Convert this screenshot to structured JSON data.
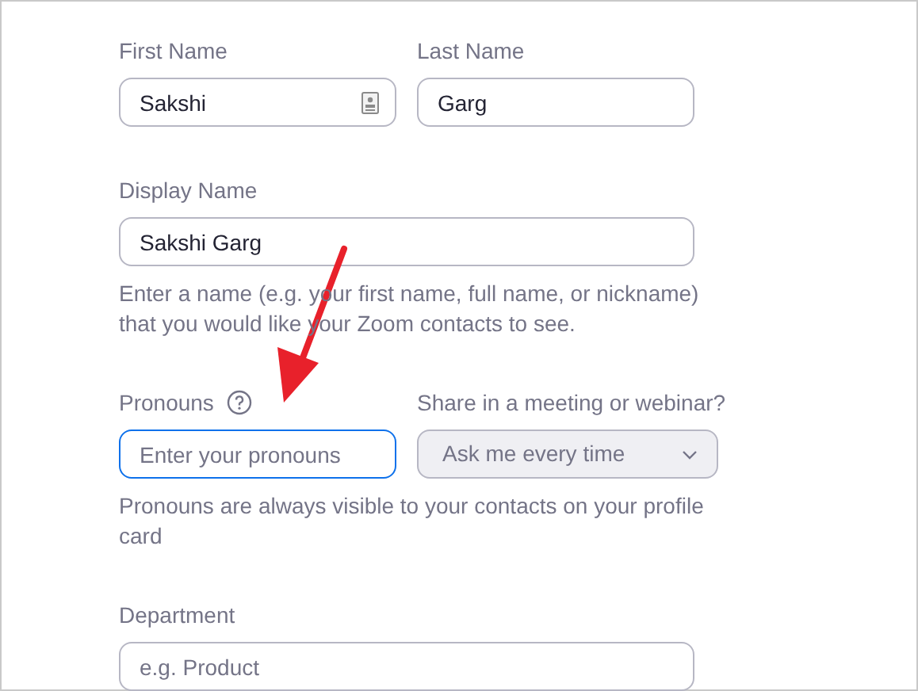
{
  "rows": [
    {
      "fields": [
        {
          "kind": "text",
          "label": "First Name",
          "value": "Sakshi",
          "focused": false,
          "autofill": true
        },
        {
          "kind": "text",
          "label": "Last Name",
          "value": "Garg",
          "focused": false,
          "autofill": false
        }
      ]
    },
    {
      "fields": [
        {
          "kind": "wide",
          "label": "Display Name",
          "value": "Sakshi Garg",
          "focused": false,
          "autofill": false
        }
      ],
      "hint": "Enter a name (e.g. your first name, full name, or nickname) that you would like your Zoom contacts to see."
    },
    {
      "fields": [
        {
          "kind": "text",
          "label": "Pronouns",
          "help": true,
          "placeholder": "Enter your pronouns",
          "focused": true,
          "autofill": false
        },
        {
          "kind": "select",
          "label": "Share in a meeting or webinar?",
          "value": "Ask me every time"
        }
      ],
      "hint": "Pronouns are always visible to your contacts on your profile card"
    },
    {
      "fields": [
        {
          "kind": "wide",
          "label": "Department",
          "placeholder": "e.g. Product",
          "focused": false,
          "autofill": false
        }
      ]
    }
  ]
}
